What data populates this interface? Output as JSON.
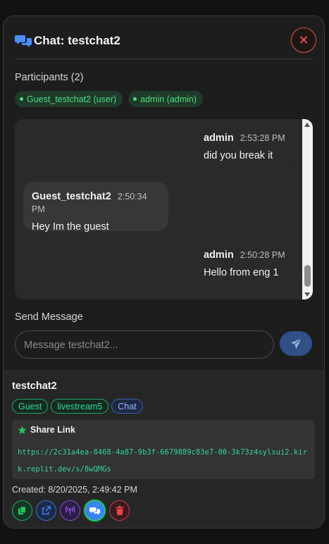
{
  "header": {
    "title": "Chat: testchat2",
    "close_label": "✕"
  },
  "participants": {
    "label": "Participants (2)",
    "items": [
      {
        "label": "Guest_testchat2 (user)"
      },
      {
        "label": "admin (admin)"
      }
    ]
  },
  "messages": [
    {
      "sender": "admin",
      "time": "2:53:28 PM",
      "text": "did you break it",
      "mine": true
    },
    {
      "sender": "Guest_testchat2",
      "time": "2:50:34 PM",
      "text": "Hey Im the guest",
      "mine": false
    },
    {
      "sender": "admin",
      "time": "2:50:28 PM",
      "text": "Hello from eng 1",
      "mine": true
    }
  ],
  "composer": {
    "label": "Send Message",
    "placeholder": "Message testchat2..."
  },
  "footer": {
    "room_name": "testchat2",
    "tags": [
      "Guest",
      "livestream5",
      "Chat"
    ],
    "share_title": "Share Link",
    "share_url": "https://2c31a4ea-8468-4a87-9b3f-6679889c83e7-00-3k73z4sylsui2.kirk.replit.dev/s/8wQMGs",
    "created": "Created: 8/20/2025, 2:49:42 PM"
  },
  "actions": [
    {
      "icon": "copy-icon",
      "color": "#22c55e"
    },
    {
      "icon": "external-link-icon",
      "color": "#3b82f6"
    },
    {
      "icon": "broadcast-icon",
      "color": "#a855f7"
    },
    {
      "icon": "chat-icon",
      "color": "#3b82f6"
    },
    {
      "icon": "trash-icon",
      "color": "#ef4444"
    }
  ]
}
